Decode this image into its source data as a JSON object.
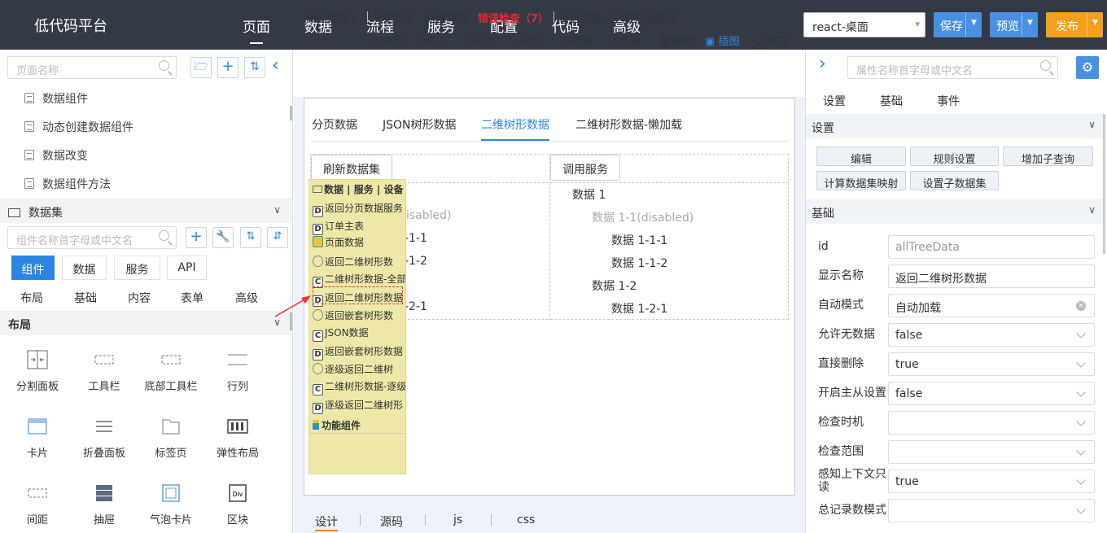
{
  "topbar": {
    "brand": "低代码平台",
    "nav": [
      "页面",
      "数据",
      "流程",
      "服务",
      "配置",
      "代码",
      "高级"
    ],
    "active_nav": "页面",
    "env_select": "react-桌面",
    "save": "保存",
    "preview": "预览",
    "publish": "发布",
    "colors": {
      "bg": "#333a45",
      "save": "#4a90e2",
      "preview": "#4a90e2",
      "publish": "#f5a01a"
    }
  },
  "left": {
    "page_search_placeholder": "页面名称",
    "tree_items": [
      "数据组件",
      "动态创建数据组件",
      "数据改变",
      "数据组件方法"
    ],
    "dataset_title": "数据集",
    "component_search_placeholder": "组件名称首字母或中文名",
    "tabs": [
      "组件",
      "数据",
      "服务",
      "API"
    ],
    "categories": [
      "布局",
      "基础",
      "内容",
      "表单",
      "高级"
    ],
    "layout_section": "布局",
    "components": [
      {
        "label": "分割面板",
        "icon": "split-panel-icon"
      },
      {
        "label": "工具栏",
        "icon": "toolbar-icon"
      },
      {
        "label": "底部工具栏",
        "icon": "bottom-toolbar-icon"
      },
      {
        "label": "行列",
        "icon": "row-column-icon"
      },
      {
        "label": "卡片",
        "icon": "card-icon"
      },
      {
        "label": "折叠面板",
        "icon": "collapse-panel-icon"
      },
      {
        "label": "标签页",
        "icon": "tab-page-icon"
      },
      {
        "label": "弹性布局",
        "icon": "flex-layout-icon"
      },
      {
        "label": "间距",
        "icon": "spacing-icon"
      },
      {
        "label": "抽屉",
        "icon": "drawer-icon"
      },
      {
        "label": "气泡卡片",
        "icon": "popover-card-icon"
      },
      {
        "label": "区块",
        "icon": "div-block-icon"
      }
    ]
  },
  "center": {
    "toolbar": {
      "page_structure": "页面结构",
      "history": "历史版本",
      "conflict": "处理冲突",
      "error_check": "错误检查（7）",
      "log_trace": "日志跟踪",
      "gen_source": "生成页面源码",
      "refresh": "刷新",
      "up": "向上",
      "forward": "向前",
      "backward": "向后",
      "undo": "撤销",
      "redo": "重做",
      "delete": "删除",
      "insert": "插图",
      "preview": "预览"
    },
    "tabs": [
      "分页数据",
      "JSON树形数据",
      "二维树形数据",
      "二维树形数据-懒加载"
    ],
    "active_tab": "二维树形数据",
    "buttons": {
      "refresh_dataset": "刷新数据集",
      "call_service": "调用服务"
    },
    "left_tree_partial": [
      {
        "text": "isabled)",
        "dis": true
      },
      {
        "text": "-1-1"
      },
      {
        "text": "-1-2"
      },
      {
        "text": "-2-1"
      }
    ],
    "right_tree": [
      {
        "text": "数据 1",
        "dis": false
      },
      {
        "text": "数据 1-1(disabled)",
        "dis": true
      },
      {
        "text": "数据 1-1-1",
        "dis": false
      },
      {
        "text": "数据 1-1-2",
        "dis": false
      },
      {
        "text": "数据 1-2",
        "dis": false
      },
      {
        "text": "数据 1-2-1",
        "dis": false
      }
    ],
    "popup": {
      "header": "数据 | 服务 | 设备",
      "items": [
        {
          "badge": "D",
          "text": "返回分页数据服务"
        },
        {
          "badge": "D",
          "text": "订单主表"
        },
        {
          "badge": "P",
          "text": "页面数据"
        },
        {
          "badge": "G",
          "text": "返回二维树形数"
        },
        {
          "badge": "C",
          "text": "二维树形数据-全部"
        },
        {
          "badge": "D",
          "text": "返回二维树形数据"
        },
        {
          "badge": "G",
          "text": "返回嵌套树形数"
        },
        {
          "badge": "C",
          "text": "JSON数据"
        },
        {
          "badge": "D",
          "text": "返回嵌套树形数据"
        },
        {
          "badge": "G",
          "text": "逐级返回二维树"
        },
        {
          "badge": "C",
          "text": "二维树形数据-逐级"
        },
        {
          "badge": "D",
          "text": "逐级返回二维树形"
        }
      ],
      "footer": "功能组件",
      "bg": "#eee8a8"
    },
    "bottom_tabs": [
      "设计",
      "源码",
      "js",
      "css"
    ],
    "active_bottom": "设计"
  },
  "right": {
    "search_placeholder": "属性名称首字母或中文名",
    "tabs": [
      "设置",
      "基础",
      "事件"
    ],
    "settings_section": "设置",
    "setting_buttons": [
      "编辑",
      "规则设置",
      "增加子查询",
      "计算数据集映射",
      "设置子数据集"
    ],
    "basic_section": "基础",
    "props": [
      {
        "label": "id",
        "value": "allTreeData",
        "kind": "text",
        "ph": true
      },
      {
        "label": "显示名称",
        "value": "返回二维树形数据",
        "kind": "text"
      },
      {
        "label": "自动模式",
        "value": "自动加载",
        "kind": "clear"
      },
      {
        "label": "允许无数据",
        "value": "false",
        "kind": "select"
      },
      {
        "label": "直接删除",
        "value": "true",
        "kind": "select"
      },
      {
        "label": "开启主从设置",
        "value": "false",
        "kind": "select"
      },
      {
        "label": "检查时机",
        "value": "",
        "kind": "select"
      },
      {
        "label": "检查范围",
        "value": "",
        "kind": "select"
      },
      {
        "label": "感知上下文只读",
        "value": "true",
        "kind": "select"
      },
      {
        "label": "总记录数模式",
        "value": "",
        "kind": "select"
      }
    ]
  }
}
